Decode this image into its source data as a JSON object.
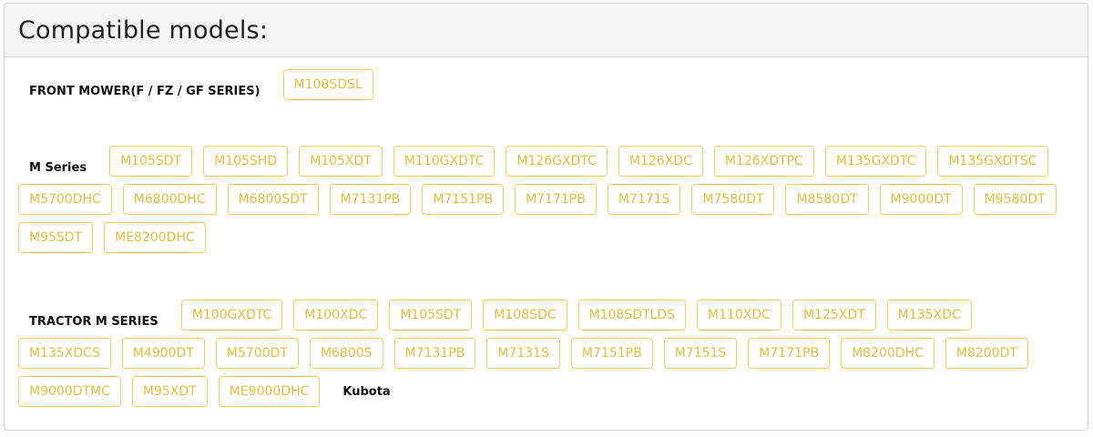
{
  "panel": {
    "title": "Compatible models:"
  },
  "groups": [
    {
      "label": "FRONT MOWER(F / FZ / GF SERIES)",
      "models": [
        "M108SDSL"
      ]
    },
    {
      "label": "M Series",
      "models": [
        "M105SDT",
        "M105SHD",
        "M105XDT",
        "M110GXDTC",
        "M126GXDTC",
        "M126XDC",
        "M126XDTPC",
        "M135GXDTC",
        "M135GXDTSC",
        "M5700DHC",
        "M6800DHC",
        "M6800SDT",
        "M7131PB",
        "M7151PB",
        "M7171PB",
        "M7171S",
        "M7580DT",
        "M8580DT",
        "M9000DT",
        "M9580DT",
        "M95SDT",
        "ME8200DHC"
      ]
    },
    {
      "label": "TRACTOR M SERIES",
      "models": [
        "M100GXDTC",
        "M100XDC",
        "M105SDT",
        "M108SDC",
        "M108SDTLDS",
        "M110XDC",
        "M125XDT",
        "M135XDC",
        "M135XDCS",
        "M4900DT",
        "M5700DT",
        "M6800S",
        "M7131PB",
        "M7131S",
        "M7151PB",
        "M7151S",
        "M7171PB",
        "M8200DHC",
        "M8200DT",
        "M9000DTMC",
        "M95XDT",
        "ME9000DHC"
      ]
    }
  ],
  "brand": "Kubota",
  "colors": {
    "tag_border": "#f0d060",
    "tag_text": "#e0c043",
    "header_bg": "#f5f5f5"
  }
}
